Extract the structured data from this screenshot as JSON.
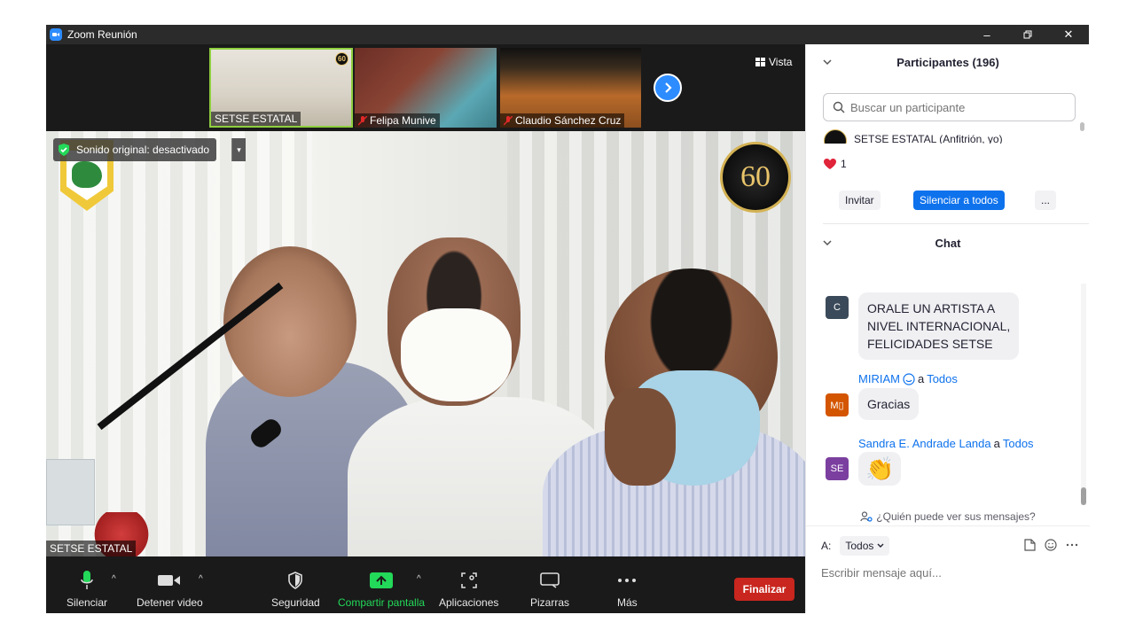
{
  "window": {
    "title": "Zoom Reunión"
  },
  "strip": {
    "tiles": [
      {
        "name": "SETSE ESTATAL"
      },
      {
        "name": "Felipa Munive"
      },
      {
        "name": "Claudio Sánchez Cruz"
      }
    ],
    "view_label": "Vista"
  },
  "main_video": {
    "sound_status": "Sonido original: desactivado",
    "badge_number": "60",
    "name": "SETSE ESTATAL"
  },
  "toolbar": {
    "mute": "Silenciar",
    "stop_video": "Detener video",
    "security": "Seguridad",
    "share": "Compartir pantalla",
    "apps": "Aplicaciones",
    "whiteboards": "Pizarras",
    "more": "Más",
    "end": "Finalizar"
  },
  "participants": {
    "header": "Participantes (196)",
    "search_placeholder": "Buscar un participante",
    "first_row": "SETSE ESTATAL (Anfitrión, yo)",
    "reaction_count": "1",
    "invite": "Invitar",
    "mute_all": "Silenciar a todos",
    "more": "..."
  },
  "chat": {
    "header": "Chat",
    "messages": [
      {
        "avatar": "C",
        "avatar_color": "#3b4a5a",
        "text_lines": [
          "ORALE UN ARTISTA A",
          "NIVEL INTERNACIONAL,",
          "FELICIDADES SETSE"
        ]
      },
      {
        "sender": "MIRIAM",
        "to_word": "a",
        "to": "Todos",
        "avatar": "M▯",
        "avatar_color": "#d45500",
        "text": "Gracias"
      },
      {
        "sender": "Sandra E. Andrade Landa",
        "to_word": "a",
        "to": "Todos",
        "avatar": "SE",
        "avatar_color": "#7b3fa0",
        "text": "👏"
      }
    ],
    "who_sees": "¿Quién puede ver sus mensajes?",
    "to_label": "A:",
    "to_value": "Todos",
    "compose_placeholder": "Escribir mensaje aquí..."
  },
  "colors": {
    "accent": "#0e72ed",
    "end": "#c8261e",
    "share": "#23d959",
    "active_speaker": "#8fcf3f"
  }
}
